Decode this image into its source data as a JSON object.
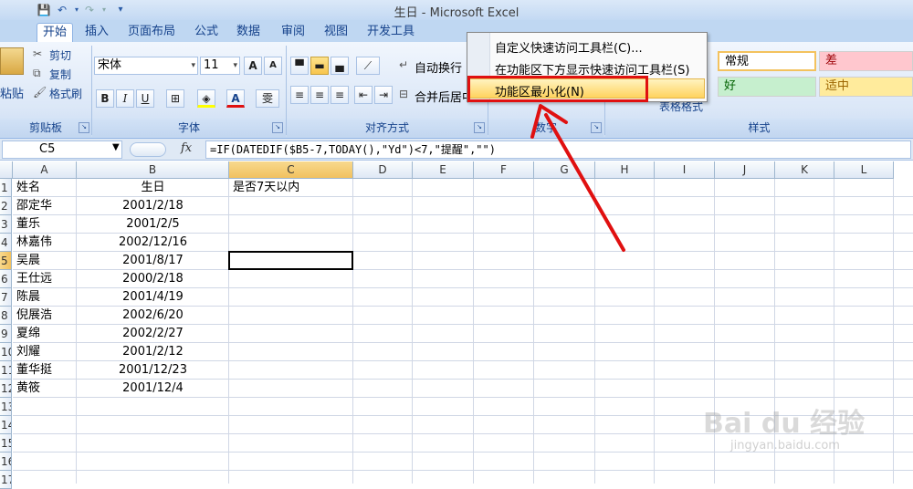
{
  "window": {
    "title": "生日 - Microsoft Excel"
  },
  "qat": {
    "customize_glyph": "▾"
  },
  "tabs": [
    {
      "label": "开始",
      "active": true
    },
    {
      "label": "插入"
    },
    {
      "label": "页面布局"
    },
    {
      "label": "公式"
    },
    {
      "label": "数据"
    },
    {
      "label": "审阅"
    },
    {
      "label": "视图"
    },
    {
      "label": "开发工具"
    }
  ],
  "clipboard": {
    "paste": "粘贴",
    "cut": "剪切",
    "copy": "复制",
    "format_painter": "格式刷",
    "group": "剪贴板"
  },
  "font": {
    "name": "宋体",
    "size": "11",
    "grow": "A",
    "shrink": "A",
    "bold": "B",
    "italic": "I",
    "underline": "U",
    "color_glyph": "A",
    "phonetic": "雯",
    "group": "字体"
  },
  "alignment": {
    "wrap": "自动换行",
    "merge": "合并后居中",
    "group": "对齐方式"
  },
  "number": {
    "group": "数字"
  },
  "styles": {
    "cell_styles": "表格格式",
    "normal": "常规",
    "bad": "差",
    "good": "好",
    "neutral": "适中",
    "group": "样式",
    "bad_bg": "#ffc7ce",
    "bad_fg": "#9c0006",
    "good_bg": "#c6efce",
    "good_fg": "#006100",
    "neutral_bg": "#ffeb9c",
    "neutral_fg": "#9c6500"
  },
  "menu": {
    "items": [
      {
        "label": "自定义快速访问工具栏(C)..."
      },
      {
        "label": "在功能区下方显示快速访问工具栏(S)"
      },
      {
        "label": "功能区最小化(N)",
        "highlighted": true
      }
    ]
  },
  "formula_bar": {
    "cell_ref": "C5",
    "fx": "fx",
    "formula": "=IF(DATEDIF($B5-7,TODAY(),\"Yd\")<7,\"提醒\",\"\")"
  },
  "columns": [
    "A",
    "B",
    "C",
    "D",
    "E",
    "F",
    "G",
    "H",
    "I",
    "J",
    "K",
    "L"
  ],
  "rows": [
    "1",
    "2",
    "3",
    "4",
    "5",
    "6",
    "7",
    "8",
    "9",
    "10",
    "11",
    "12",
    "13",
    "14",
    "15",
    "16",
    "17"
  ],
  "selected": {
    "column": "C",
    "row": "5"
  },
  "cells": [
    {
      "row": 1,
      "col": "A",
      "v": "姓名"
    },
    {
      "row": 1,
      "col": "B",
      "v": "生日"
    },
    {
      "row": 1,
      "col": "C",
      "v": "是否7天以内"
    },
    {
      "row": 2,
      "col": "A",
      "v": "邵定华"
    },
    {
      "row": 2,
      "col": "B",
      "v": "2001/2/18"
    },
    {
      "row": 3,
      "col": "A",
      "v": "董乐"
    },
    {
      "row": 3,
      "col": "B",
      "v": "2001/2/5"
    },
    {
      "row": 4,
      "col": "A",
      "v": "林嘉伟"
    },
    {
      "row": 4,
      "col": "B",
      "v": "2002/12/16"
    },
    {
      "row": 5,
      "col": "A",
      "v": "吴晨"
    },
    {
      "row": 5,
      "col": "B",
      "v": "2001/8/17"
    },
    {
      "row": 6,
      "col": "A",
      "v": "王仕远"
    },
    {
      "row": 6,
      "col": "B",
      "v": "2000/2/18"
    },
    {
      "row": 7,
      "col": "A",
      "v": "陈晨"
    },
    {
      "row": 7,
      "col": "B",
      "v": "2001/4/19"
    },
    {
      "row": 8,
      "col": "A",
      "v": "倪展浩"
    },
    {
      "row": 8,
      "col": "B",
      "v": "2002/6/20"
    },
    {
      "row": 9,
      "col": "A",
      "v": "夏绵"
    },
    {
      "row": 9,
      "col": "B",
      "v": "2002/2/27"
    },
    {
      "row": 10,
      "col": "A",
      "v": "刘耀"
    },
    {
      "row": 10,
      "col": "B",
      "v": "2001/2/12"
    },
    {
      "row": 11,
      "col": "A",
      "v": "董华挺"
    },
    {
      "row": 11,
      "col": "B",
      "v": "2001/12/23"
    },
    {
      "row": 12,
      "col": "A",
      "v": "黄筱"
    },
    {
      "row": 12,
      "col": "B",
      "v": "2001/12/4"
    }
  ],
  "watermark": {
    "brand": "Bai du 经验",
    "url": "jingyan.baidu.com"
  },
  "colors": {
    "accent": "#15428b",
    "annotation": "#e01010",
    "selection": "#000000"
  }
}
